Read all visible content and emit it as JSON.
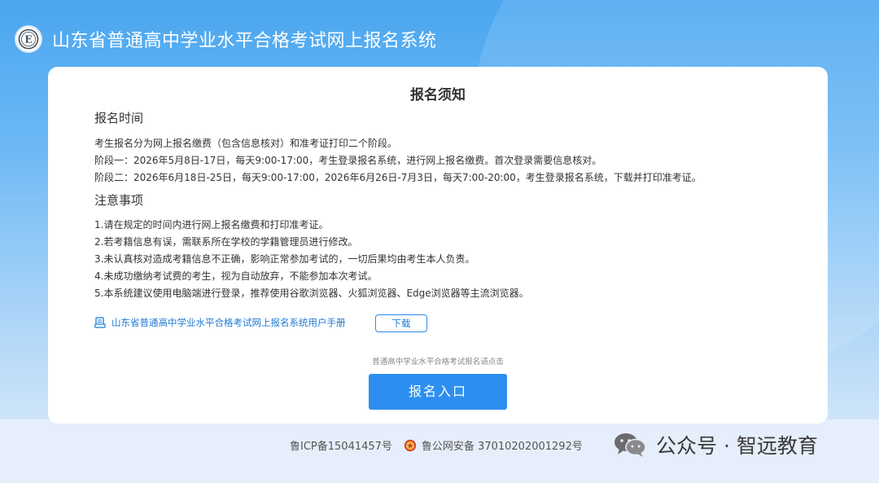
{
  "header": {
    "title": "山东省普通高中学业水平合格考试网上报名系统",
    "logo_icon": "emblem-e-logo"
  },
  "notice": {
    "title": "报名须知",
    "time_section": {
      "heading": "报名时间",
      "lines": [
        "考生报名分为网上报名缴费（包含信息核对）和准考证打印二个阶段。",
        "阶段一：2026年5月8日-17日，每天9:00-17:00，考生登录报名系统，进行网上报名缴费。首次登录需要信息核对。",
        "阶段二：2026年6月18日-25日，每天9:00-17:00，2026年6月26日-7月3日，每天7:00-20:00，考生登录报名系统，下载并打印准考证。"
      ]
    },
    "notes_section": {
      "heading": "注意事项",
      "lines": [
        "1.请在规定的时间内进行网上报名缴费和打印准考证。",
        "2.若考籍信息有误，需联系所在学校的学籍管理员进行修改。",
        "3.未认真核对造成考籍信息不正确，影响正常参加考试的，一切后果均由考生本人负责。",
        "4.未成功缴纳考试费的考生，视为自动放弃，不能参加本次考试。",
        "5.本系统建议使用电脑端进行登录，推荐使用谷歌浏览器、火狐浏览器、Edge浏览器等主流浏览器。"
      ]
    },
    "manual": {
      "icon": "document-icon",
      "label": "山东省普通高中学业水平合格考试网上报名系统用户手册",
      "download_label": "下载"
    },
    "entry_hint": "普通高中学业水平合格考试报名请点击",
    "entry_button": "报名入口"
  },
  "footer": {
    "icp": "鲁ICP备15041457号",
    "police_label": "鲁公网安备 37010202001292号",
    "police_icon": "police-badge-icon"
  },
  "watermark": {
    "text": "公众号 · 智远教育",
    "icon": "wechat-icon"
  },
  "colors": {
    "primary": "#2c8ff0",
    "link": "#1f7ad6",
    "text": "#333333"
  }
}
